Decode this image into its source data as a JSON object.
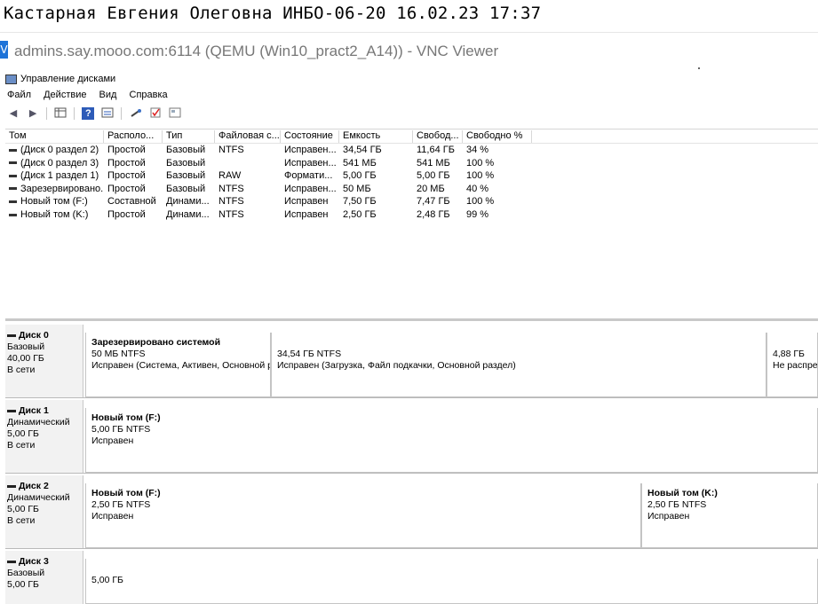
{
  "caption": "Кастарная Евгения Олеговна ИНБО-06-20 16.02.23 17:37",
  "vnc": {
    "title": "admins.say.mooo.com:6114 (QEMU (Win10_pract2_A14)) - VNC Viewer",
    "icon": "vnc-icon"
  },
  "app": {
    "title": "Управление дисками",
    "menu": [
      "Файл",
      "Действие",
      "Вид",
      "Справка"
    ],
    "toolbar_icons": [
      "back-icon",
      "forward-icon",
      "console-tree-icon",
      "help-icon",
      "properties-icon",
      "connect-icon",
      "check-icon",
      "view-icon"
    ]
  },
  "table": {
    "headers": [
      "Том",
      "Располо...",
      "Тип",
      "Файловая с...",
      "Состояние",
      "Емкость",
      "Свобод...",
      "Свободно %"
    ],
    "rows": [
      [
        "(Диск 0 раздел 2)",
        "Простой",
        "Базовый",
        "NTFS",
        "Исправен...",
        "34,54 ГБ",
        "11,64 ГБ",
        "34 %"
      ],
      [
        "(Диск 0 раздел 3)",
        "Простой",
        "Базовый",
        "",
        "Исправен...",
        "541 МБ",
        "541 МБ",
        "100 %"
      ],
      [
        "(Диск 1 раздел 1)",
        "Простой",
        "Базовый",
        "RAW",
        "Формати...",
        "5,00 ГБ",
        "5,00 ГБ",
        "100 %"
      ],
      [
        "Зарезервировано...",
        "Простой",
        "Базовый",
        "NTFS",
        "Исправен...",
        "50 МБ",
        "20 МБ",
        "40 %"
      ],
      [
        "Новый том (F:)",
        "Составной",
        "Динами...",
        "NTFS",
        "Исправен",
        "7,50 ГБ",
        "7,47 ГБ",
        "100 %"
      ],
      [
        "Новый том (K:)",
        "Простой",
        "Динами...",
        "NTFS",
        "Исправен",
        "2,50 ГБ",
        "2,48 ГБ",
        "99 %"
      ]
    ]
  },
  "disks": [
    {
      "name": "Диск 0",
      "type": "Базовый",
      "size": "40,00 ГБ",
      "status": "В сети",
      "partitions": [
        {
          "title": "Зарезервировано системой",
          "line1": "50 МБ NTFS",
          "line2": "Исправен (Система, Активен, Основной раздел)",
          "color": "#0a1aa0"
        },
        {
          "title": "",
          "line1": "34,54 ГБ NTFS",
          "line2": "Исправен (Загрузка, Файл подкачки, Основной раздел)",
          "color": "#0a1aa0"
        },
        {
          "title": "",
          "line1": "4,88 ГБ",
          "line2": "Не распределена",
          "color": "#000000"
        }
      ]
    },
    {
      "name": "Диск 1",
      "type": "Динамический",
      "size": "5,00 ГБ",
      "status": "В сети",
      "partitions": [
        {
          "title": "Новый том  (F:)",
          "line1": "5,00 ГБ NTFS",
          "line2": "Исправен",
          "color": "#a0149c"
        }
      ]
    },
    {
      "name": "Диск 2",
      "type": "Динамический",
      "size": "5,00 ГБ",
      "status": "В сети",
      "partitions": [
        {
          "title": "Новый том  (F:)",
          "line1": "2,50 ГБ NTFS",
          "line2": "Исправен",
          "color": "#a0149c"
        },
        {
          "title": "Новый том  (K:)",
          "line1": "2,50 ГБ NTFS",
          "line2": "Исправен",
          "color": "#a8a810"
        }
      ]
    },
    {
      "name": "Диск 3",
      "type": "Базовый",
      "size": "5,00 ГБ",
      "status": "",
      "partitions": [
        {
          "title": "",
          "line1": "5,00 ГБ",
          "line2": "",
          "color": "#000000"
        }
      ]
    }
  ]
}
